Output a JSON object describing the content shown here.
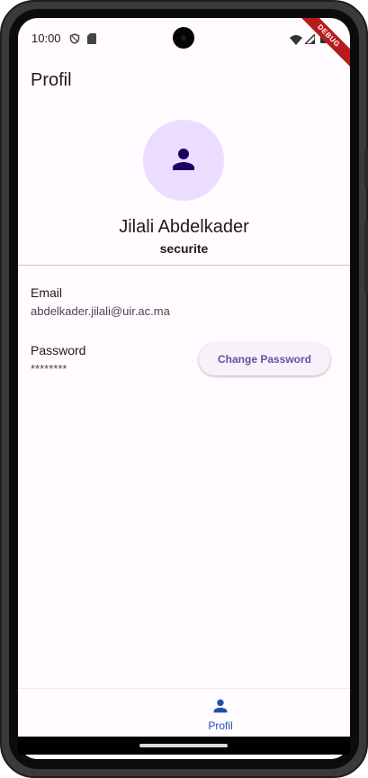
{
  "status_bar": {
    "time": "10:00",
    "left_icons": [
      "shield-icon",
      "sd-card-icon"
    ],
    "right_icons": [
      "wifi-icon",
      "cellular-signal-icon",
      "battery-icon"
    ]
  },
  "debug_banner": "DEBUG",
  "page": {
    "title": "Profil"
  },
  "profile": {
    "avatar_icon": "person-icon",
    "name": "Jilali Abdelkader",
    "role": "securite"
  },
  "fields": {
    "email_label": "Email",
    "email_value": "abdelkader.jilali@uir.ac.ma",
    "password_label": "Password",
    "password_value": "********",
    "change_password_label": "Change Password"
  },
  "bottom_nav": {
    "items": [
      {
        "label": "Profil",
        "icon": "person-icon",
        "selected": true
      }
    ]
  },
  "colors": {
    "primary": "#6750a4",
    "avatar_bg": "#eaddff",
    "avatar_fg": "#21005d",
    "nav_selected": "#1e4fb0",
    "debug_ribbon": "#b71c1c",
    "surface": "#fffbfe"
  }
}
